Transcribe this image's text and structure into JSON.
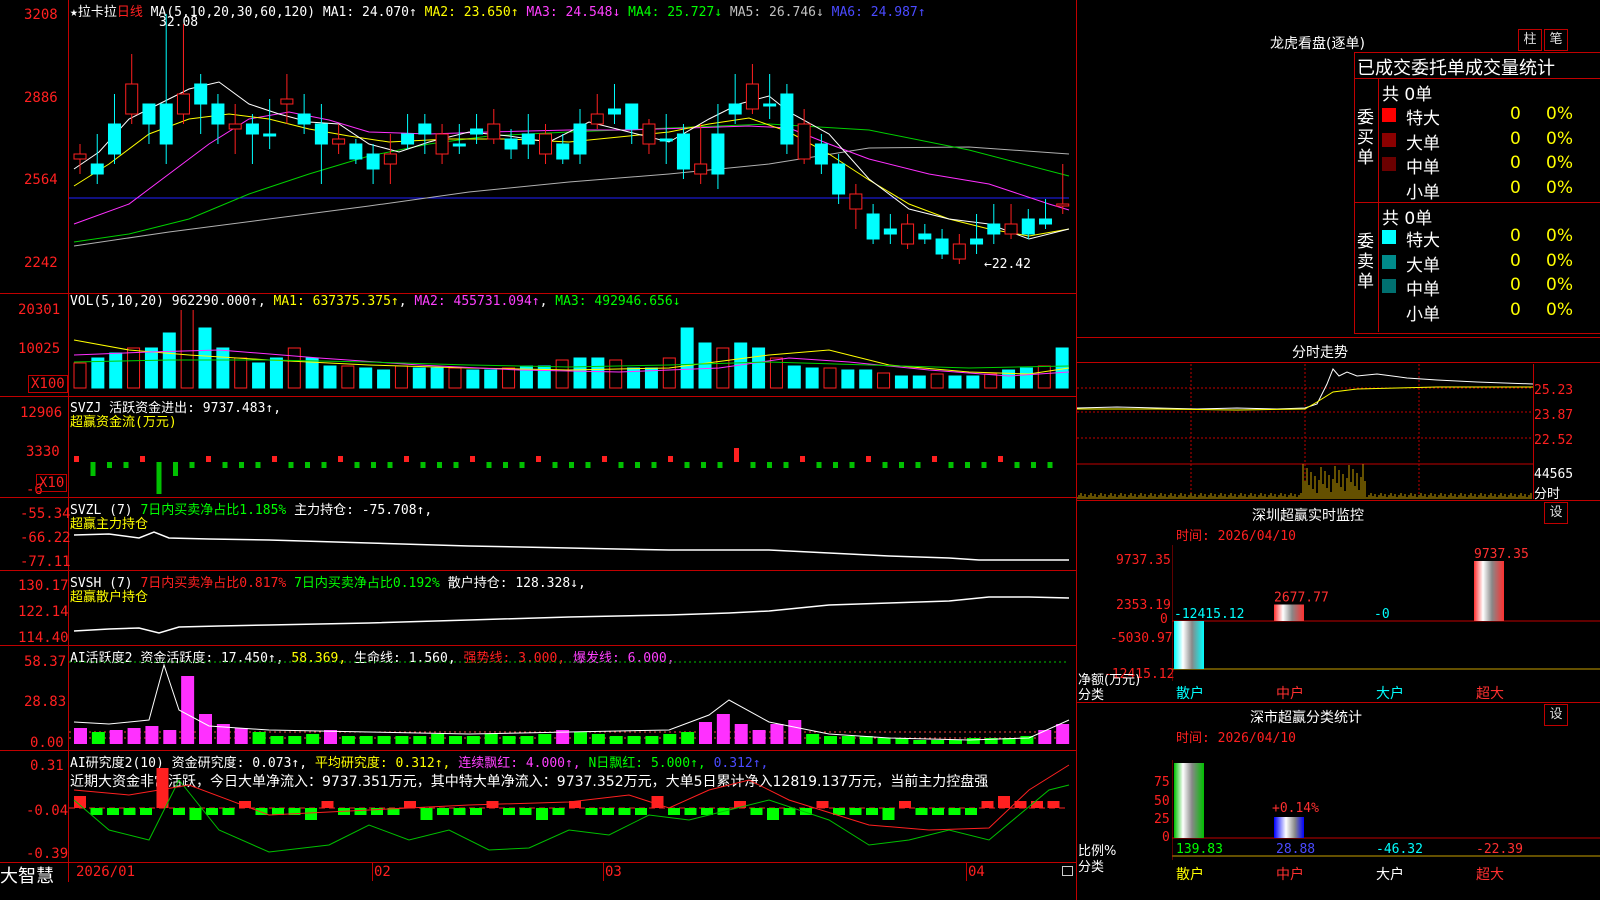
{
  "app": {
    "brand": "大智慧"
  },
  "main": {
    "kline": {
      "header_prefix": "★拉卡拉",
      "header_period": "日线",
      "ma_label": "MA(5,10,20,30,60,120)",
      "ma1": "MA1: 24.070↑",
      "ma2": "MA2: 23.650↑",
      "ma3": "MA3: 24.548↓",
      "ma4": "MA4: 25.727↓",
      "ma5": "MA5: 26.746↓",
      "ma6": "MA6: 24.987↑",
      "high_note": "32.08",
      "low_note": "←22.42",
      "yticks": [
        "3208",
        "2886",
        "2564",
        "2242"
      ]
    },
    "vol": {
      "label": "VOL(5,10,20)",
      "value": "962290.000↑",
      "ma1": "MA1: 637375.375↑",
      "ma2": "MA2: 455731.094↑",
      "ma3": "MA3: 492946.656↓",
      "yticks": [
        "20301",
        "10025",
        "X100"
      ]
    },
    "svzj": {
      "label": "SVZJ",
      "desc": "活跃资金进出: 9737.483↑,",
      "sub": "超赢资金流(万元)",
      "yticks": [
        "12906",
        "3330",
        "-6",
        "X10"
      ]
    },
    "svzl": {
      "label": "SVZL (7)",
      "desc1": "7日内买卖净占比1.185%",
      "desc2": "主力持仓: -75.708↑,",
      "sub": "超赢主力持仓",
      "yticks": [
        "-55.34",
        "-66.22",
        "-77.11"
      ]
    },
    "svsh": {
      "label": "SVSH (7)",
      "desc1": "7日内买卖净占比0.817%",
      "desc2": "7日内买卖净占比0.192%",
      "desc3": "散户持仓: 128.328↓,",
      "sub": "超赢散户持仓",
      "yticks": [
        "130.17",
        "122.14",
        "114.40"
      ]
    },
    "ai1": {
      "label": "AI活跃度2",
      "d1": "资金活跃度: 17.450↑,",
      "d2": "58.369,",
      "d3": "生命线: 1.560,",
      "d4": "强势线: 3.000,",
      "d5": "爆发线: 6.000,",
      "yticks": [
        "58.37",
        "28.83",
        "0.00"
      ]
    },
    "ai2": {
      "label": "AI研究度2(10)",
      "d1": "资金研究度: 0.073↑,",
      "d2": "平均研究度: 0.312↑,",
      "d3": "连续飘红: 4.000↑,",
      "d4": "N日飘红: 5.000↑,",
      "d5": "0.312↑,",
      "comment": "近期大资金非常活跃，今日大单净流入：9737.351万元，其中特大单净流入：9737.352万元，大单5日累计净入12819.137万元，当前主力控盘强",
      "yticks": [
        "0.31",
        "-0.04",
        "-0.39"
      ]
    },
    "xaxis": [
      "2026/01",
      "02",
      "03",
      "04"
    ]
  },
  "right": {
    "dragon": {
      "title": "龙虎看盘(逐单)",
      "btn1": "柱",
      "btn2": "笔",
      "header": "已成交委托单成交量统计",
      "buy_label": "委买单",
      "sell_label": "委卖单",
      "buy_total": "共 0单",
      "sell_total": "共 0单",
      "buy_rows": [
        {
          "name": "特大",
          "count": "0",
          "pct": "0%",
          "color": "#ff0000"
        },
        {
          "name": "大单",
          "count": "0",
          "pct": "0%",
          "color": "#8b0000"
        },
        {
          "name": "中单",
          "count": "0",
          "pct": "0%",
          "color": "#6b0000"
        },
        {
          "name": "小单",
          "count": "0",
          "pct": "0%",
          "color": "#000000"
        }
      ],
      "sell_rows": [
        {
          "name": "特大",
          "count": "0",
          "pct": "0%",
          "color": "#00ffff"
        },
        {
          "name": "大单",
          "count": "0",
          "pct": "0%",
          "color": "#008b8b"
        },
        {
          "name": "中单",
          "count": "0",
          "pct": "0%",
          "color": "#007070"
        },
        {
          "name": "小单",
          "count": "0",
          "pct": "0%",
          "color": "#000000"
        }
      ]
    },
    "intraday": {
      "title": "分时走势",
      "yticks": [
        "25.23",
        "23.87",
        "22.52",
        "44565"
      ],
      "unit": "分时"
    },
    "monitor": {
      "title": "深圳超赢实时监控",
      "btn": "设",
      "date": "时间: 2026/04/10",
      "yticks": [
        "9737.35",
        "2353.19",
        "0",
        "-5030.97",
        "-12415.12"
      ],
      "ylabel": "净额(万元)",
      "xlabel_title": "分类",
      "categories": [
        "散户",
        "中户",
        "大户",
        "超大"
      ],
      "values_text": [
        "-12415.12",
        "2677.77",
        "-0",
        "9737.35"
      ]
    },
    "classify": {
      "title": "深市超赢分类统计",
      "btn": "设",
      "date": "时间: 2026/04/10",
      "yticks": [
        "75",
        "50",
        "25",
        "0"
      ],
      "ylabel": "比例%",
      "xlabel_title": "分类",
      "categories": [
        "散户",
        "中户",
        "大户",
        "超大"
      ],
      "values_text": [
        "139.83",
        "28.88",
        "-46.32",
        "-22.39"
      ],
      "annot": "+0.14%"
    }
  },
  "chart_data": {
    "type": "bar",
    "title": "深圳超赢实时监控",
    "categories": [
      "散户",
      "中户",
      "大户",
      "超大"
    ],
    "values": [
      -12415.12,
      2677.77,
      0,
      9737.35
    ],
    "ylabel": "净额(万元)",
    "ylim": [
      -12415.12,
      9737.35
    ]
  }
}
